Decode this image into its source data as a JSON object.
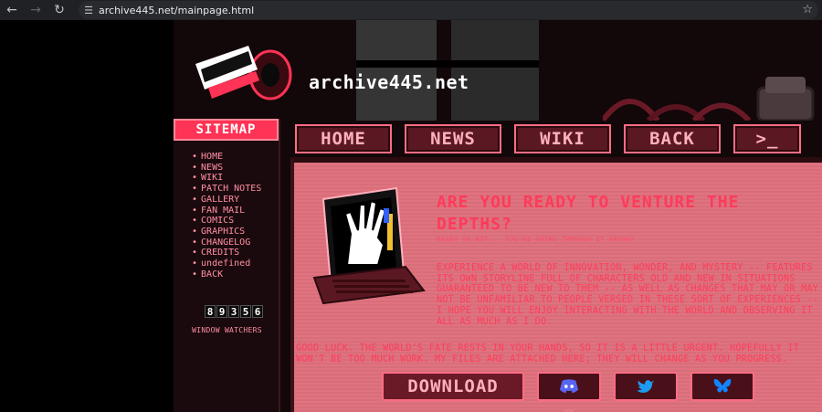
{
  "browser": {
    "url": "archive445.net/mainpage.html",
    "icons": {
      "back": "arrow-left-icon",
      "forward": "arrow-right-icon",
      "reload": "reload-icon",
      "site_info": "tune-icon",
      "bookmark": "star-icon"
    }
  },
  "header": {
    "site_name": "archive445.net"
  },
  "sidebar": {
    "title": "SITEMAP",
    "items": [
      "HOME",
      "NEWS",
      "WIKI",
      "PATCH NOTES",
      "GALLERY",
      "FAN MAIL",
      "COMICS",
      "GRAPHICS",
      "CHANGELOG",
      "CREDITS",
      "undefined",
      "BACK"
    ],
    "counter_digits": [
      "8",
      "9",
      "3",
      "5",
      "6"
    ],
    "counter_label": "WINDOW WATCHERS"
  },
  "nav": {
    "home": "HOME",
    "news": "NEWS",
    "wiki": "WIKI",
    "back": "BACK",
    "terminal": ">_"
  },
  "content": {
    "headline": "ARE YOU READY TO VENTURE THE DEPTHS?",
    "subline": "READY OR NOT... YOU'RE GOING THROUGH IT ANYWAY",
    "paragraph1": "EXPERIENCE A WORLD OF INNOVATION, WONDER, AND MYSTERY -- FEATURES ITS OWN STORYLINE FULL OF CHARACTERS OLD AND NEW IN SITUATIONS GUARANTEED TO BE NEW TO THEM -- AS WELL AS CHANGES THAT MAY OR MAY NOT BE UNFAMILIAR TO PEOPLE VERSED IN THESE SORT OF EXPERIENCES -- I HOPE YOU WILL ENJOY INTERACTING WITH THE WORLD AND OBSERVING IT ALL AS MUCH AS I DO.",
    "paragraph2": "GOOD LUCK. THE WORLD'S FATE RESTS IN YOUR HANDS, SO IT IS A LITTLE URGENT. HOPEFULLY IT WON'T BE TOO MUCH WORK. MY FILES ARE ATTACHED HERE; THEY WILL CHANGE AS YOU PROGRESS.",
    "download_label": "DOWNLOAD",
    "footer_mark": "=="
  },
  "social": {
    "discord_icon": "discord-icon",
    "twitter_icon": "twitter-icon",
    "bluesky_icon": "bluesky-icon"
  },
  "colors": {
    "accent": "#ff3355",
    "panel": "#e0737f",
    "text_red": "#ff3e5c",
    "discord": "#5865f2",
    "twitter": "#1d9bf0",
    "bluesky": "#1185fe"
  }
}
